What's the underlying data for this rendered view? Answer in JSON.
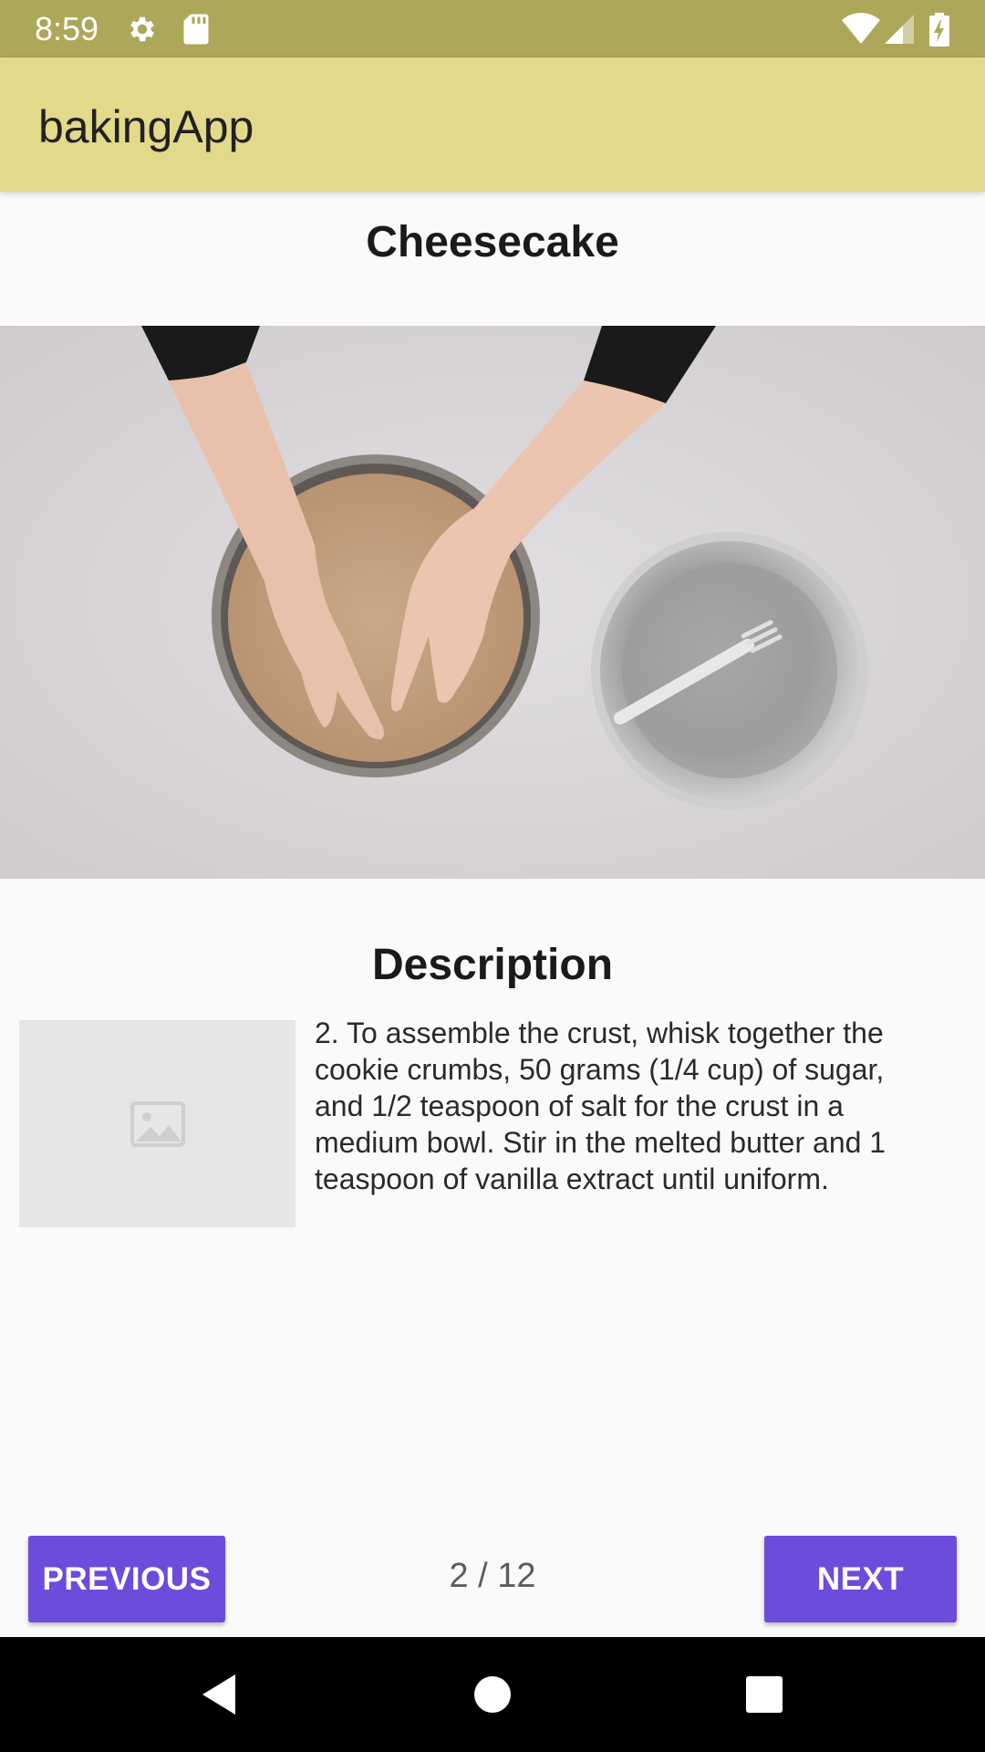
{
  "status_bar": {
    "time": "8:59",
    "icons": [
      "gear-icon",
      "sd-card-icon",
      "wifi-icon",
      "signal-icon",
      "battery-charging-icon"
    ]
  },
  "app_bar": {
    "title": "bakingApp"
  },
  "recipe": {
    "name": "Cheesecake"
  },
  "video": {
    "icon": "video-player"
  },
  "description": {
    "heading": "Description",
    "thumbnail_icon": "image-placeholder-icon",
    "text": "2. To assemble the crust, whisk together the cookie crumbs, 50 grams (1/4 cup) of sugar, and 1/2 teaspoon of salt for the crust in a medium bowl. Stir in the melted butter and 1 teaspoon of vanilla extract until uniform."
  },
  "navigation": {
    "previous_label": "PREVIOUS",
    "next_label": "NEXT",
    "counter": "2 / 12"
  },
  "system_nav": {
    "icons": [
      "back-icon",
      "home-icon",
      "recents-icon"
    ]
  },
  "colors": {
    "status_bar": "#ada75a",
    "app_bar": "#e2d98a",
    "button": "#6d4bdb",
    "background": "#fafafa"
  }
}
